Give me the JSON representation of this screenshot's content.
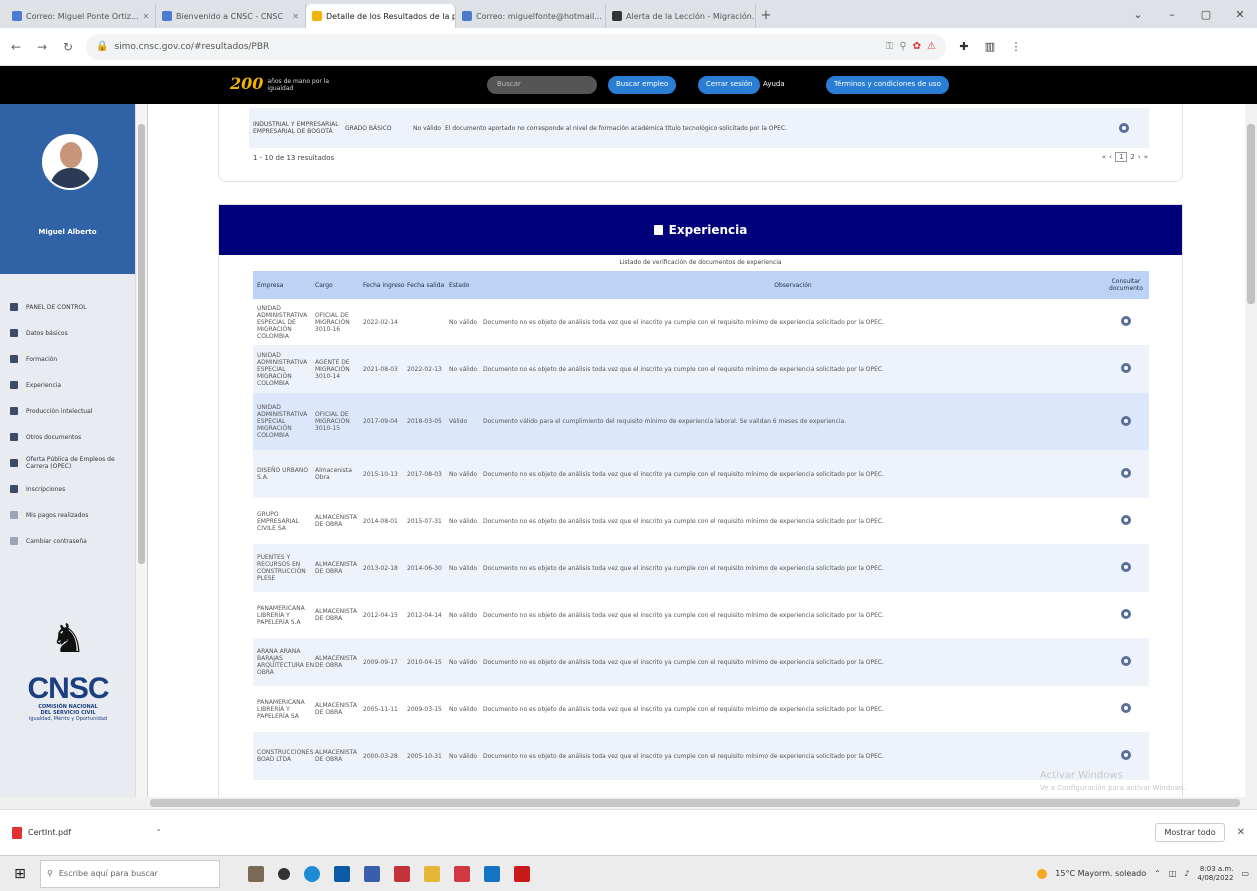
{
  "browser": {
    "tabs": [
      {
        "label": "Correo: Miguel Ponte Ortiz..."
      },
      {
        "label": "Bienvenido a CNSC - CNSC"
      },
      {
        "label": "Detalle de los Resultados de la p..."
      },
      {
        "label": "Correo: miguelfonte@hotmail..."
      },
      {
        "label": "Alerta de la Lección - Migración..."
      }
    ],
    "new_tab": "+",
    "url": "simo.cnsc.gov.co/#resultados/PBR"
  },
  "site_header": {
    "logo_number": "200",
    "logo_text": "años de mano por la igualdad",
    "search_placeholder": "Buscar",
    "buttons": {
      "search_jobs": "Buscar empleo",
      "logout": "Cerrar sesión",
      "help": "Ayuda",
      "terms": "Términos y condiciones de uso"
    }
  },
  "sidebar": {
    "user_name": "Miguel Alberto",
    "menu": [
      {
        "label": "PANEL DE CONTROL"
      },
      {
        "label": "Datos básicos"
      },
      {
        "label": "Formación"
      },
      {
        "label": "Experiencia"
      },
      {
        "label": "Producción intelectual"
      },
      {
        "label": "Otros documentos"
      },
      {
        "label": "Oferta Pública de Empleos de Carrera (OPEC)"
      },
      {
        "label": "Inscripciones"
      },
      {
        "label": "Mis pagos realizados"
      },
      {
        "label": "Cambiar contraseña"
      }
    ],
    "logo": {
      "acronym": "CNSC",
      "line1": "COMISIÓN NACIONAL",
      "line2": "DEL SERVICIO CIVIL",
      "line3": "Igualdad, Mérito y Oportunidad"
    }
  },
  "formation": {
    "last_row": {
      "institution": "INDUSTRIAL Y EMPRESARIAL EMPRESARIAL DE BOGOTÁ",
      "program": "GRADO BÁSICO",
      "state": "No válido",
      "observation": "El documento aportado no corresponde al nivel de formación académica título tecnológico solicitado por la OPEC."
    },
    "results_text": "1 - 10 de 13 resultados",
    "pagination": {
      "prev_first": "«",
      "prev": "‹",
      "current": "1",
      "page2": "2",
      "next": "›",
      "last": "»"
    }
  },
  "experience": {
    "title": "Experiencia",
    "caption": "Listado de verificación de documentos de experiencia",
    "columns": {
      "empresa": "Empresa",
      "cargo": "Cargo",
      "fecha_ingreso": "Fecha ingreso",
      "fecha_salida": "Fecha salida",
      "estado": "Estado",
      "observacion": "Observación",
      "consultar": "Consultar documento"
    },
    "rows": [
      {
        "empresa": "UNIDAD ADMINISTRATIVA ESPECIAL DE MIGRACIÓN COLOMBIA",
        "cargo": "OFICIAL DE MIGRACIÓN 3010-16",
        "ingreso": "2022-02-14",
        "salida": "",
        "estado": "No válido",
        "obs": "Documento no es objeto de análisis toda vez que el inscrito ya cumple con el requisito mínimo de experiencia solicitado por la OPEC."
      },
      {
        "empresa": "UNIDAD ADMINISTRATIVA ESPECIAL MIGRACIÓN COLOMBIA",
        "cargo": "AGENTE DE MIGRACIÓN 3010-14",
        "ingreso": "2021-08-03",
        "salida": "2022-02-13",
        "estado": "No válido",
        "obs": "Documento no es objeto de análisis toda vez que el inscrito ya cumple con el requisito mínimo de experiencia solicitado por la OPEC."
      },
      {
        "empresa": "UNIDAD ADMINISTRATIVA ESPECIAL MIGRACIÓN COLOMBIA",
        "cargo": "OFICIAL DE MIGRACIÓN 3010-15",
        "ingreso": "2017-09-04",
        "salida": "2018-03-05",
        "estado": "Válido",
        "obs": "Documento válido para el cumplimiento del requisito mínimo de experiencia laboral. Se validan 6 meses de experiencia."
      },
      {
        "empresa": "DISEÑO URBANO S.A.",
        "cargo": "Almacenista Obra",
        "ingreso": "2015-10-13",
        "salida": "2017-08-03",
        "estado": "No válido",
        "obs": "Documento no es objeto de análisis toda vez que el inscrito ya cumple con el requisito mínimo de experiencia solicitado por la OPEC."
      },
      {
        "empresa": "GRUPO EMPRESARIAL CIVILE SA",
        "cargo": "ALMACENISTA DE OBRA",
        "ingreso": "2014-08-01",
        "salida": "2015-07-31",
        "estado": "No válido",
        "obs": "Documento no es objeto de análisis toda vez que el inscrito ya cumple con el requisito mínimo de experiencia solicitado por la OPEC."
      },
      {
        "empresa": "PUENTES Y RECURSOS EN CONSTRUCCIÓN PLESE",
        "cargo": "ALMACENISTA DE OBRA",
        "ingreso": "2013-02-18",
        "salida": "2014-06-30",
        "estado": "No válido",
        "obs": "Documento no es objeto de análisis toda vez que el inscrito ya cumple con el requisito mínimo de experiencia solicitado por la OPEC."
      },
      {
        "empresa": "PANAMERICANA LIBRERÍA Y PAPELERÍA S.A",
        "cargo": "ALMACENISTA DE OBRA",
        "ingreso": "2012-04-15",
        "salida": "2012-04-14",
        "estado": "No válido",
        "obs": "Documento no es objeto de análisis toda vez que el inscrito ya cumple con el requisito mínimo de experiencia solicitado por la OPEC."
      },
      {
        "empresa": "ARANA ARANA BARAJAS ARQUITECTURA EN OBRA",
        "cargo": "ALMACENISTA DE OBRA",
        "ingreso": "2009-09-17",
        "salida": "2010-04-15",
        "estado": "No válido",
        "obs": "Documento no es objeto de análisis toda vez que el inscrito ya cumple con el requisito mínimo de experiencia solicitado por la OPEC."
      },
      {
        "empresa": "PANAMERICANA LIBRERÍA Y PAPELERÍA SA",
        "cargo": "ALMACENISTA DE OBRA",
        "ingreso": "2005-11-11",
        "salida": "2009-03-15",
        "estado": "No válido",
        "obs": "Documento no es objeto de análisis toda vez que el inscrito ya cumple con el requisito mínimo de experiencia solicitado por la OPEC."
      },
      {
        "empresa": "CONSTRUCCIONES BOAD LTDA",
        "cargo": "ALMACENISTA DE OBRA",
        "ingreso": "2000-03-28",
        "salida": "2005-10-31",
        "estado": "No válido",
        "obs": "Documento no es objeto de análisis toda vez que el inscrito ya cumple con el requisito mínimo de experiencia solicitado por la OPEC."
      }
    ]
  },
  "watermark": {
    "line1": "Activar Windows",
    "line2": "Ve a Configuración para activar Windows."
  },
  "downloads": {
    "file": "CertInt.pdf",
    "show_all": "Mostrar todo"
  },
  "taskbar": {
    "search_placeholder": "Escribe aquí para buscar",
    "weather": "15°C Mayorm. soleado",
    "time": "8:03 a.m.",
    "date": "4/08/2022"
  },
  "colors": {
    "header_black": "#000000",
    "sidebar_blue": "#2f63a5",
    "exp_header_navy": "#00007a",
    "table_header": "#bcd3f5",
    "button_blue": "#2a7fd4"
  }
}
